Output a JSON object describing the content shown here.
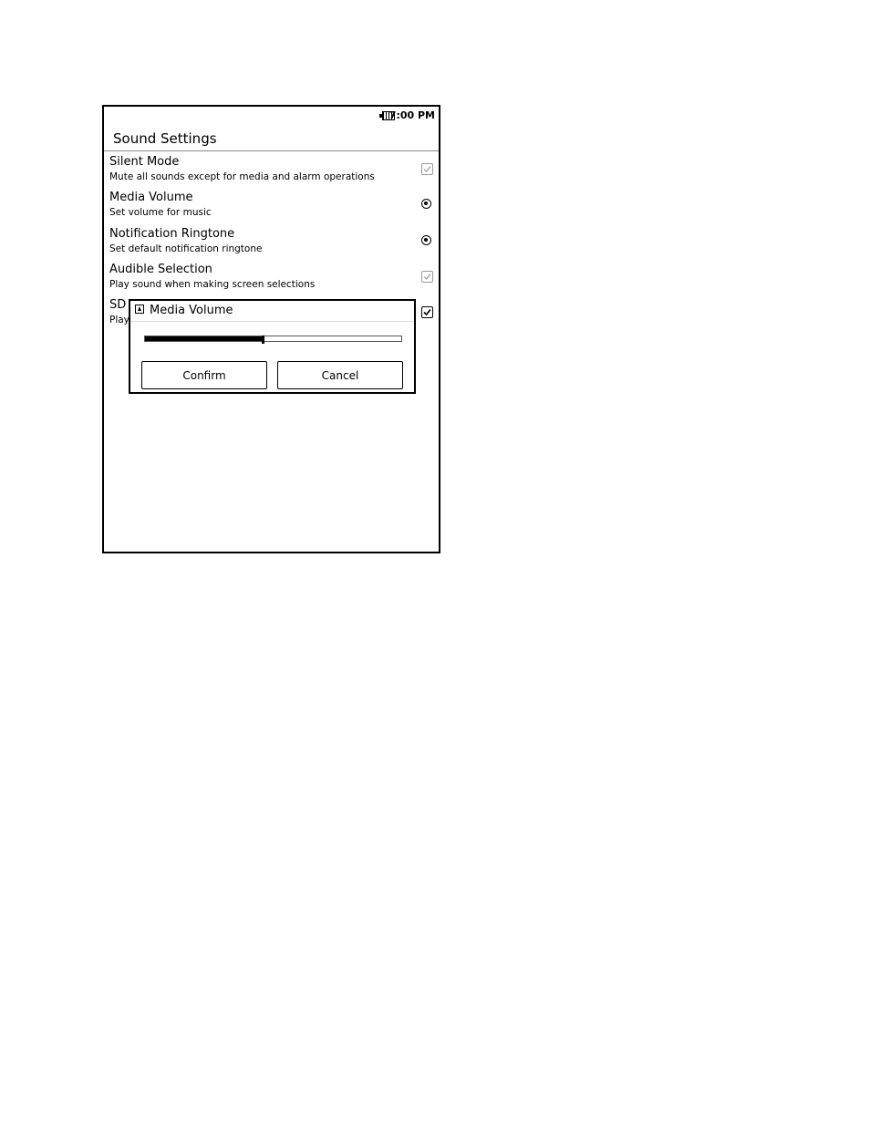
{
  "status_bar": {
    "time": "7:00 PM",
    "battery_icon": "battery-icon"
  },
  "header": {
    "title": "Sound Settings"
  },
  "settings": [
    {
      "label": "Silent Mode",
      "description": "Mute all sounds except for media and alarm operations",
      "control": "checkbox",
      "checked": true,
      "enabled": false
    },
    {
      "label": "Media Volume",
      "description": "Set volume for music",
      "control": "radio"
    },
    {
      "label": "Notification Ringtone",
      "description": "Set default notification ringtone",
      "control": "radio"
    },
    {
      "label": "Audible Selection",
      "description": "Play sound when making screen selections",
      "control": "checkbox",
      "checked": true,
      "enabled": false
    },
    {
      "label": "SD",
      "description": "Play",
      "control": "checkbox",
      "checked": true,
      "enabled": true
    }
  ],
  "dialog": {
    "title": "Media Volume",
    "volume_fraction": 0.46,
    "confirm_label": "Confirm",
    "cancel_label": "Cancel"
  }
}
